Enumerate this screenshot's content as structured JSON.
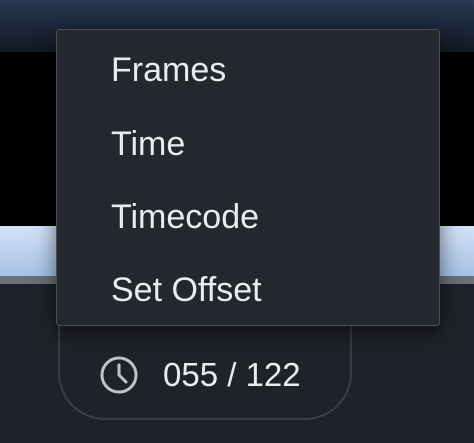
{
  "menu": {
    "items": [
      {
        "label": "Frames"
      },
      {
        "label": "Time"
      },
      {
        "label": "Timecode"
      },
      {
        "label": "Set Offset"
      }
    ]
  },
  "frame_counter": {
    "icon": "clock-icon",
    "text": "055 / 122"
  },
  "colors": {
    "menu_background": "#24272d",
    "menu_text": "#e9ebee",
    "app_background": "#1f2228",
    "timeline_band": "#a6c1e5"
  }
}
